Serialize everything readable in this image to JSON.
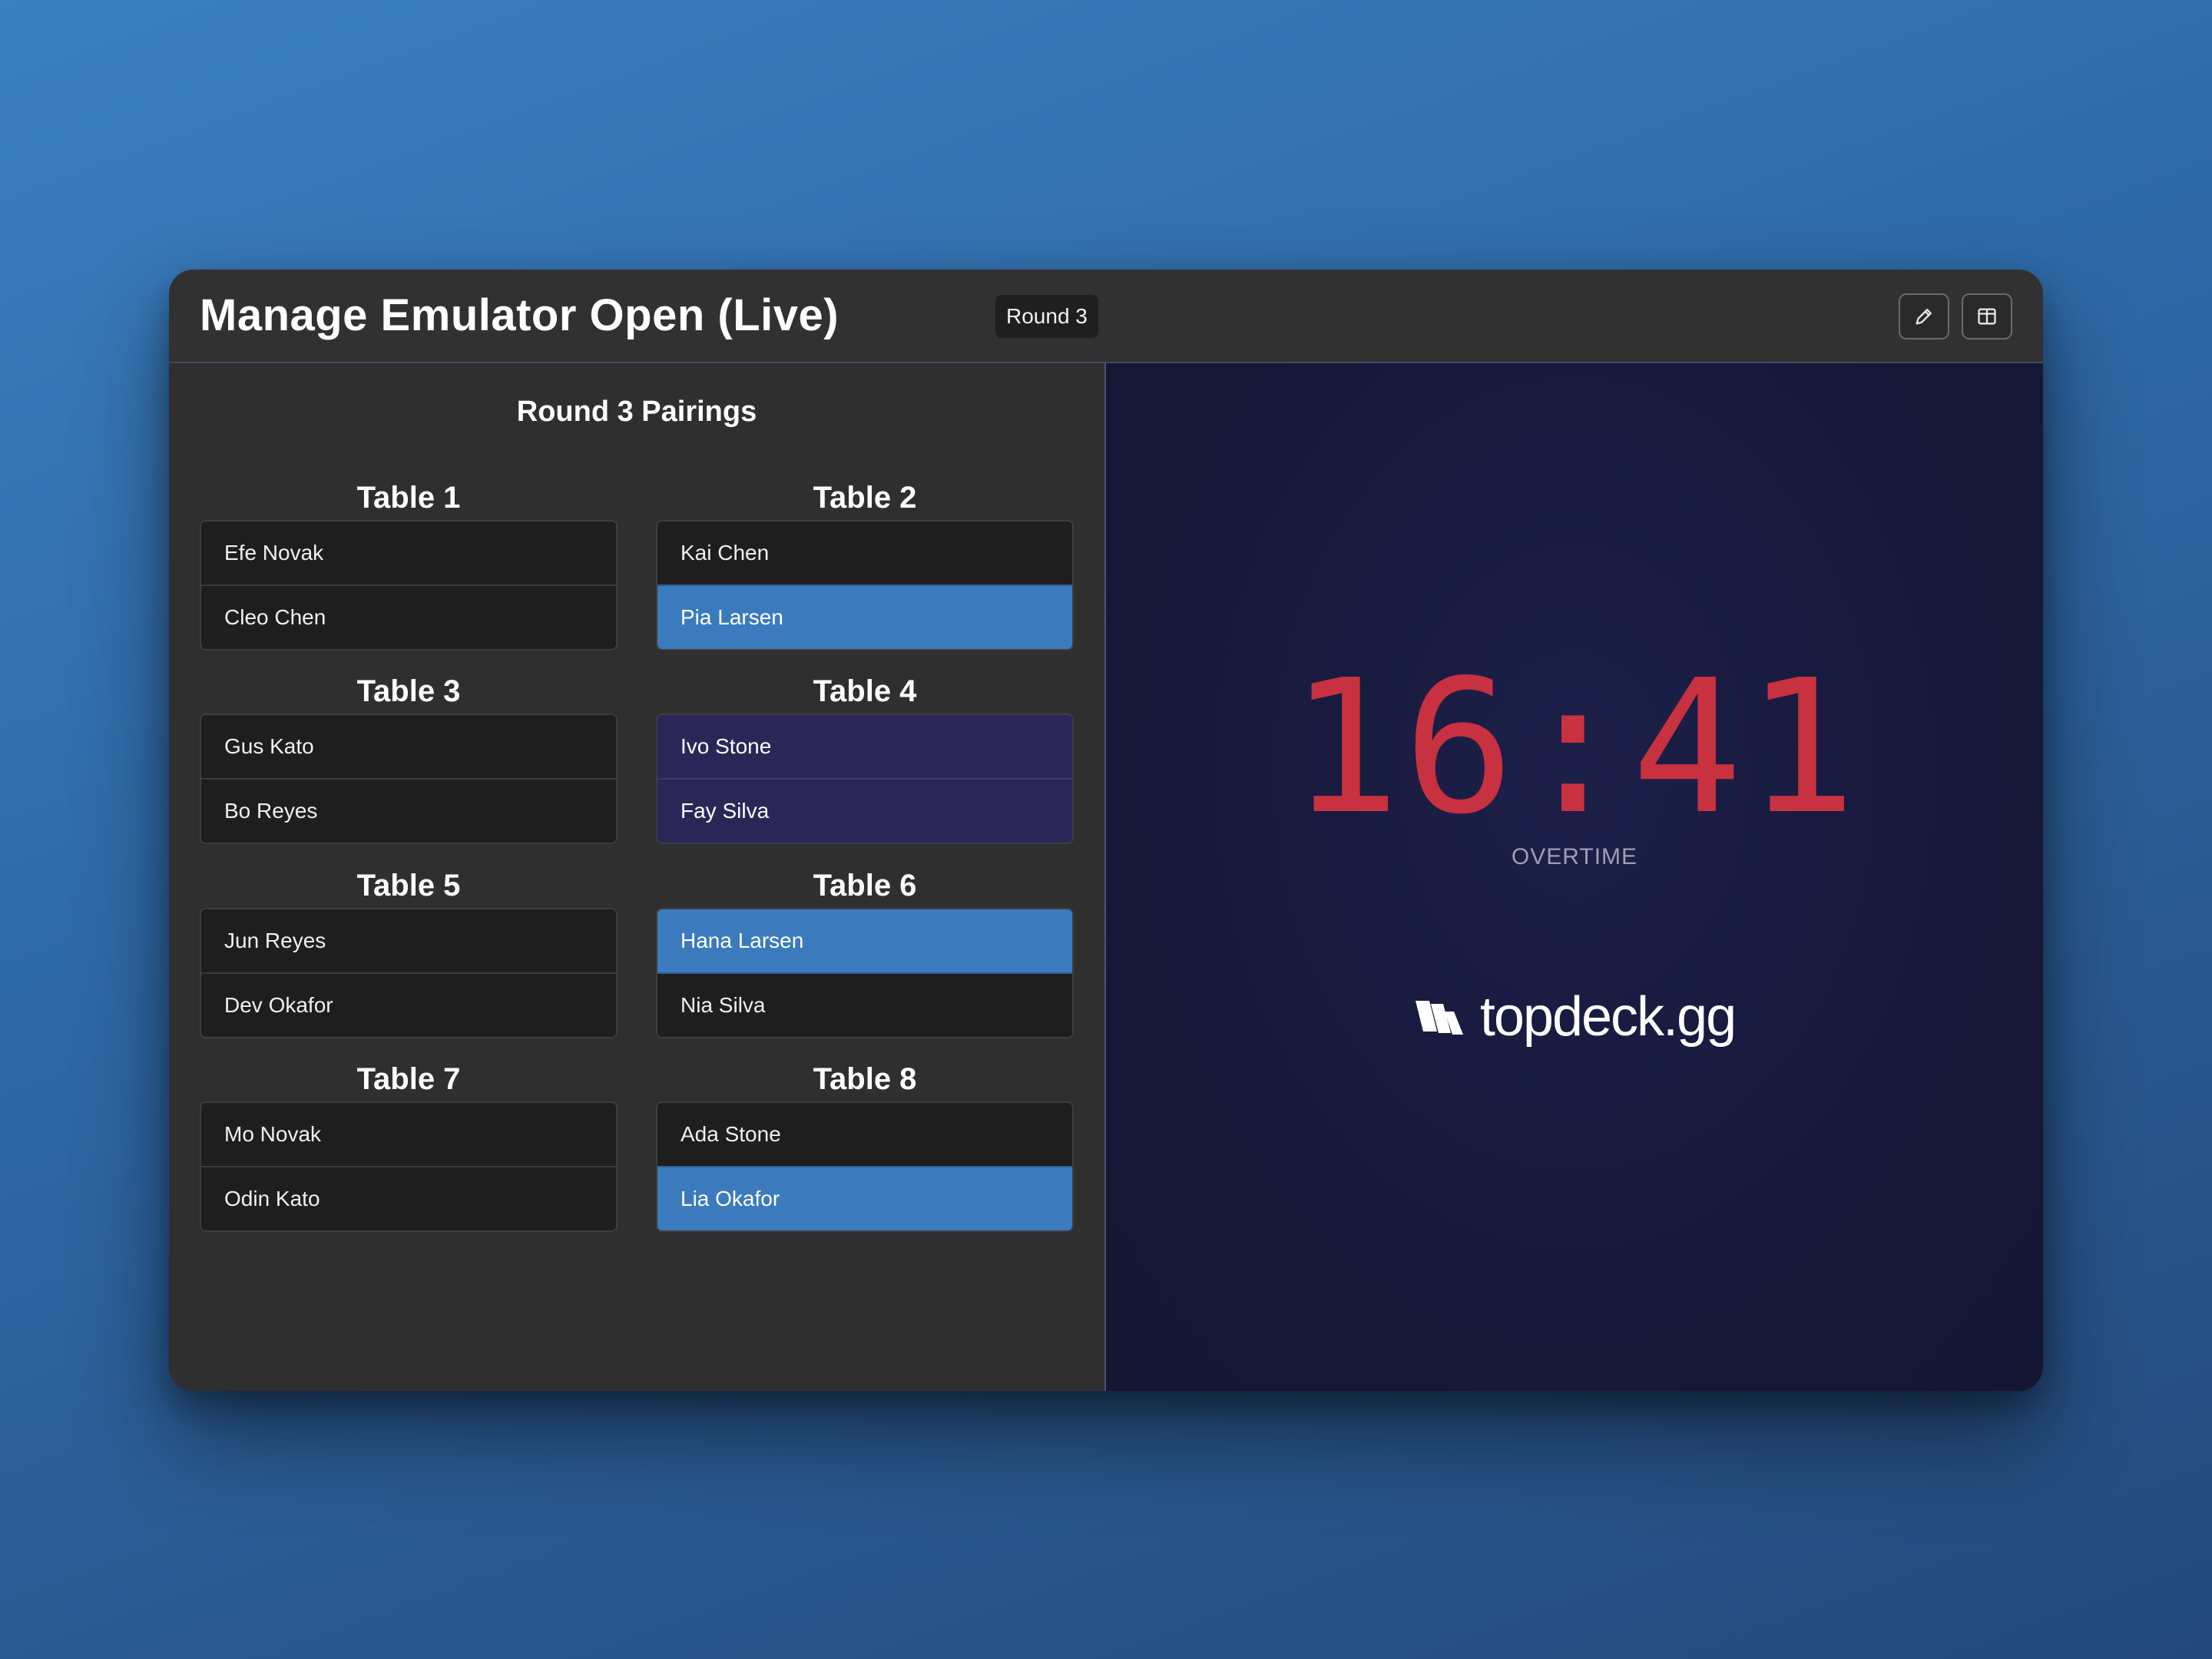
{
  "window": {
    "title": "Manage Emulator Open (Live)",
    "round_badge": "Round 3"
  },
  "toolbar": {
    "edit_icon": "pencil-icon",
    "layout_icon": "split-layout-icon"
  },
  "pairings": {
    "title": "Round 3 Pairings",
    "tables": [
      {
        "label": "Table 1",
        "players": [
          {
            "name": "Efe Novak",
            "state": "normal"
          },
          {
            "name": "Cleo Chen",
            "state": "normal"
          }
        ]
      },
      {
        "label": "Table 2",
        "players": [
          {
            "name": "Kai Chen",
            "state": "normal"
          },
          {
            "name": "Pia Larsen",
            "state": "win"
          }
        ]
      },
      {
        "label": "Table 3",
        "players": [
          {
            "name": "Gus Kato",
            "state": "normal"
          },
          {
            "name": "Bo Reyes",
            "state": "normal"
          }
        ]
      },
      {
        "label": "Table 4",
        "players": [
          {
            "name": "Ivo Stone",
            "state": "draw"
          },
          {
            "name": "Fay Silva",
            "state": "draw"
          }
        ]
      },
      {
        "label": "Table 5",
        "players": [
          {
            "name": "Jun Reyes",
            "state": "normal"
          },
          {
            "name": "Dev Okafor",
            "state": "normal"
          }
        ]
      },
      {
        "label": "Table 6",
        "players": [
          {
            "name": "Hana Larsen",
            "state": "win"
          },
          {
            "name": "Nia Silva",
            "state": "normal"
          }
        ]
      },
      {
        "label": "Table 7",
        "players": [
          {
            "name": "Mo Novak",
            "state": "normal"
          },
          {
            "name": "Odin Kato",
            "state": "normal"
          }
        ]
      },
      {
        "label": "Table 8",
        "players": [
          {
            "name": "Ada Stone",
            "state": "normal"
          },
          {
            "name": "Lia Okafor",
            "state": "win"
          }
        ]
      }
    ]
  },
  "clock": {
    "time": "16:41",
    "status": "OVERTIME"
  },
  "brand": {
    "name": "topdeck.gg",
    "logo_icon": "topdeck-logo-icon"
  },
  "colors": {
    "win": "#3b7bbd",
    "draw": "#2a2758",
    "timer": "#c8313f"
  }
}
